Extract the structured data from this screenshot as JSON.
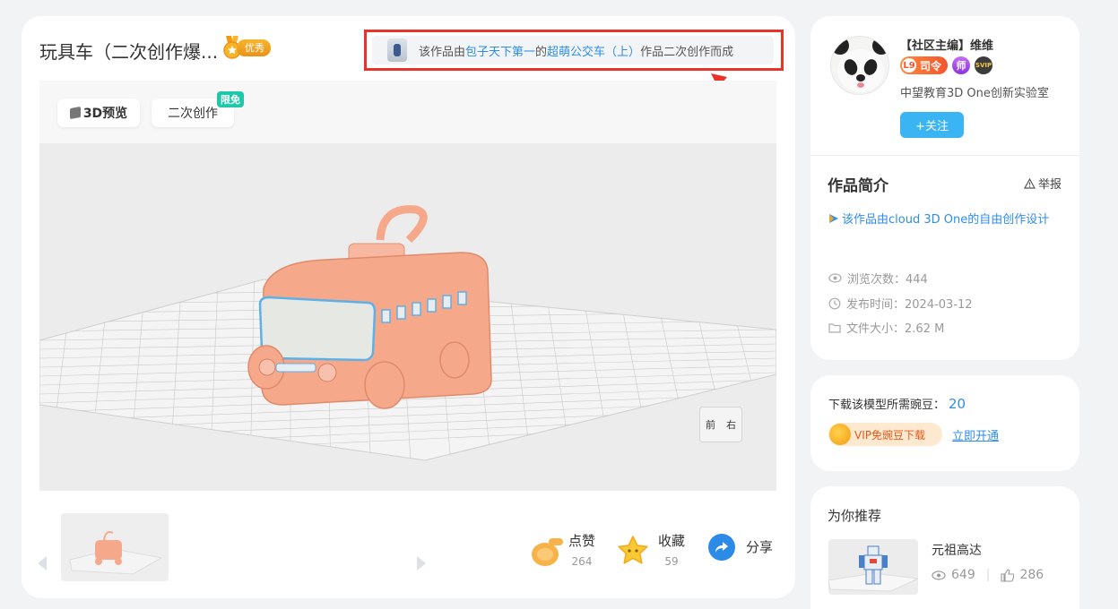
{
  "work": {
    "title": "玩具车（二次创作爆...",
    "badge_label": "优秀",
    "source": {
      "prefix": "该作品由",
      "author": "包子天下第一",
      "mid": "的 ",
      "work_name": "超萌公交车（上）",
      "suffix": "作品二次创作而成"
    }
  },
  "viewer": {
    "preview_3d_label": "3D预览",
    "remix_label": "二次创作",
    "free_tag": "限免",
    "nav_cube_front": "前",
    "nav_cube_right": "右"
  },
  "actions": {
    "like_label": "点赞",
    "like_count": "264",
    "favorite_label": "收藏",
    "favorite_count": "59",
    "share_label": "分享"
  },
  "user": {
    "name": "【社区主编】维维",
    "level_num": "L9",
    "level_title": "司令",
    "teacher_badge": "师",
    "svip_badge": "SVIP",
    "org": "中望教育3D One创新实验室",
    "follow_label": "+关注"
  },
  "intro": {
    "heading": "作品简介",
    "report_label": "举报",
    "description": "该作品由cloud 3D One的自由创作设计",
    "views_label": "浏览次数：",
    "views": "444",
    "publish_label": "发布时间：",
    "publish_date": "2024-03-12",
    "size_label": "文件大小：",
    "file_size": "2.62 M"
  },
  "download": {
    "text": "下载该模型所需豌豆：",
    "beans": "20",
    "vip_label": "VIP免豌豆下载",
    "open_link": "立即开通"
  },
  "recommend": {
    "heading": "为你推荐",
    "items": [
      {
        "name": "元祖高达",
        "views": "649",
        "likes": "286"
      }
    ]
  },
  "colors": {
    "accent_blue": "#2e8de8",
    "follow_button": "#3ab4f2",
    "highlight_red": "#e8332a",
    "model_orange": "#f5a98a"
  }
}
